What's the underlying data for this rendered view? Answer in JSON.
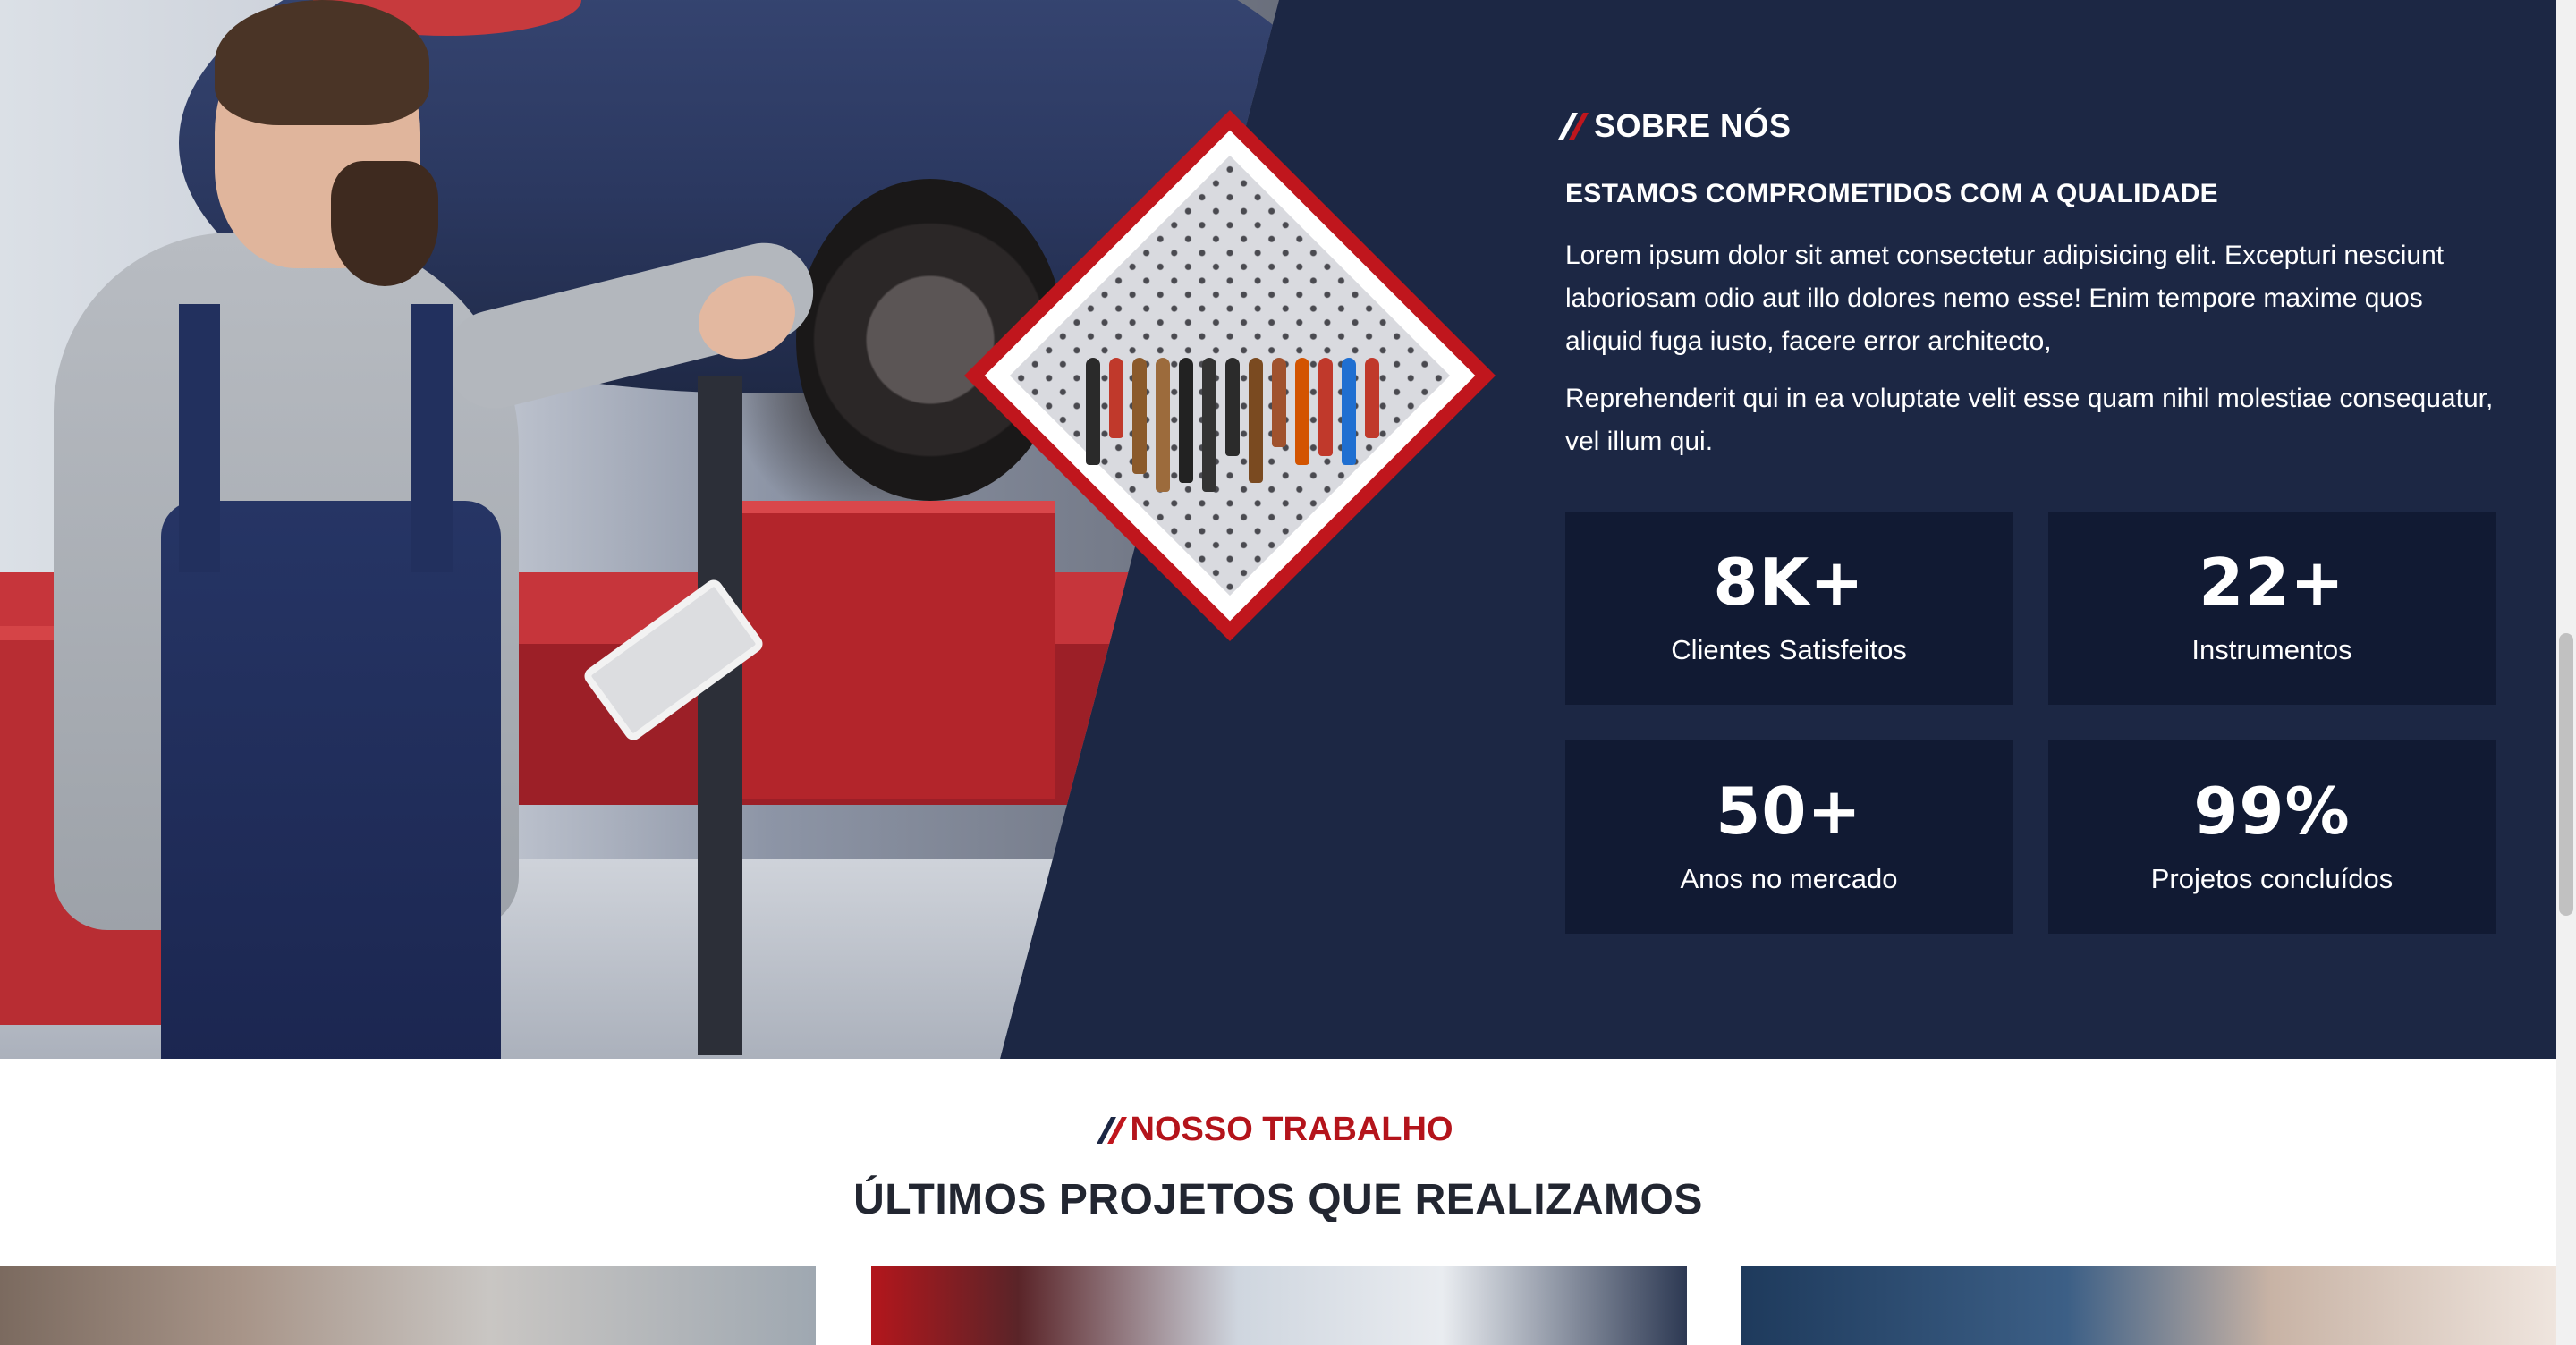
{
  "about": {
    "eyebrow": "SOBRE NÓS",
    "heading": "ESTAMOS COMPROMETIDOS COM A QUALIDADE",
    "paragraph1": "Lorem ipsum dolor sit amet consectetur adipisicing elit. Excepturi nesciunt laboriosam odio aut illo dolores nemo esse! Enim tempore maxime quos aliquid fuga iusto, facere error architecto,",
    "paragraph2": "Reprehenderit qui in ea voluptate velit esse quam nihil molestiae consequatur, vel illum qui.",
    "stats": [
      {
        "value": "8K+",
        "label": "Clientes Satisfeitos"
      },
      {
        "value": "22+",
        "label": "Instrumentos"
      },
      {
        "value": "50+",
        "label": "Anos no mercado"
      },
      {
        "value": "99%",
        "label": "Projetos concluídos"
      }
    ]
  },
  "projects": {
    "eyebrow": "NOSSO TRABALHO",
    "title": "ÚLTIMOS PROJETOS QUE REALIZAMOS"
  },
  "colors": {
    "navy": "#1c2744",
    "stat_bg": "#111a33",
    "accent_red": "#b4141b",
    "white": "#ffffff"
  },
  "icons": [
    "double-slash-icon"
  ]
}
